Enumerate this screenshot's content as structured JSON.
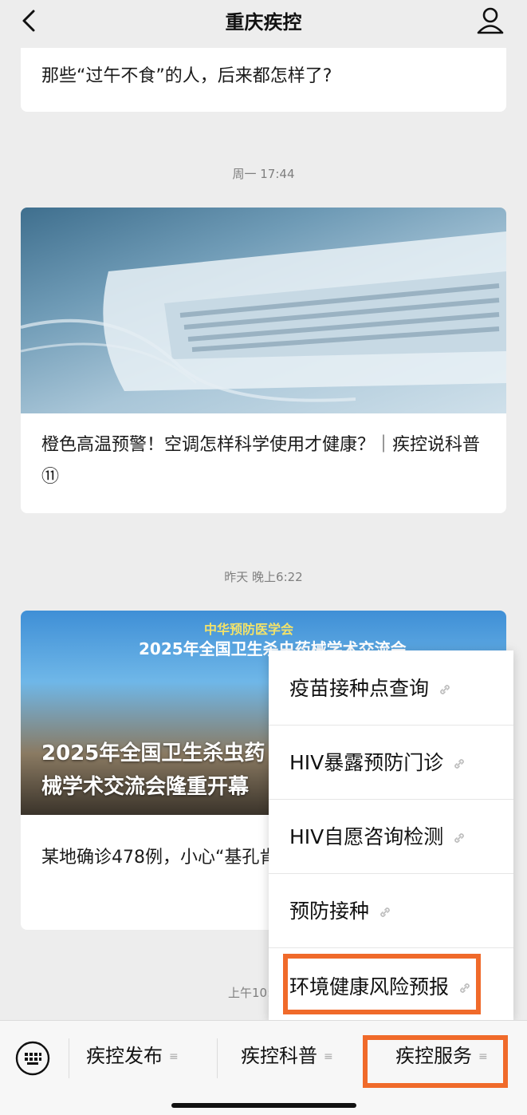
{
  "header": {
    "title": "重庆疾控",
    "back_icon": "chevron-left-icon",
    "profile_icon": "person-icon"
  },
  "messages": [
    {
      "title": "那些“过午不食”的人，后来都怎样了?"
    },
    {
      "time": "周一 17:44",
      "title": "橙色高温预警！空调怎样科学使用才健康？｜疾控说科普⑪"
    },
    {
      "time": "昨天 晚上6:22",
      "image_banner_top": "中华预防医学会",
      "image_banner_main": "2025年全国卫生杀虫药械学术交流会",
      "image_caption": "2025年全国卫生杀虫药械学术交流会隆重开幕",
      "title": "某地确诊478例，小心“基孔肯雅热”，由蚊子传播的“关节痛热”！"
    },
    {
      "time": "上午10:"
    }
  ],
  "popup_menu": {
    "items": [
      {
        "label": "疫苗接种点查询"
      },
      {
        "label": "HIV暴露预防门诊"
      },
      {
        "label": "HIV自愿咨询检测"
      },
      {
        "label": "预防接种"
      },
      {
        "label": "环境健康风险预报"
      }
    ]
  },
  "bottom_menu": {
    "keyboard_icon": "keyboard-icon",
    "tabs": [
      {
        "label": "疾控发布"
      },
      {
        "label": "疾控科普"
      },
      {
        "label": "疾控服务"
      }
    ],
    "tab_icon": "≡"
  },
  "colors": {
    "highlight": "#f06a2a",
    "background": "#ededed"
  }
}
